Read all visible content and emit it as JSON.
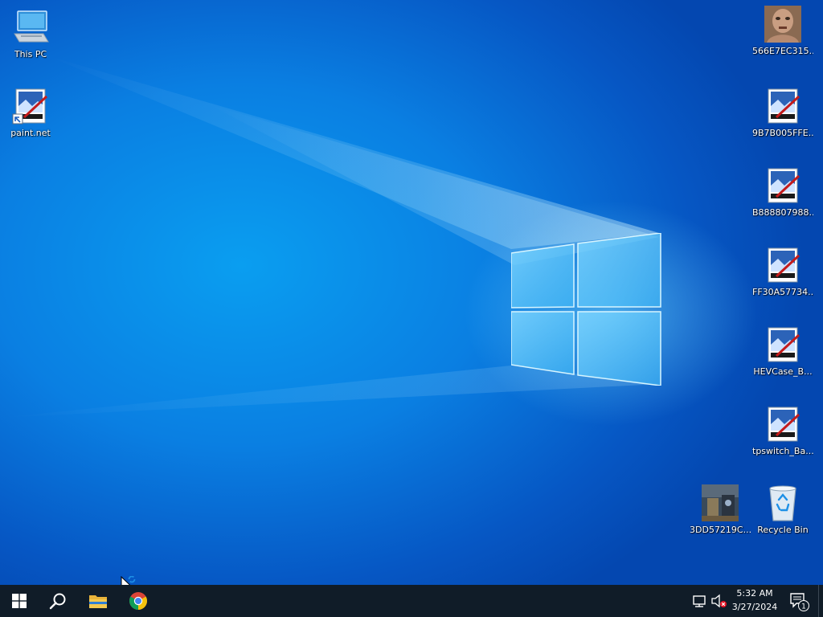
{
  "desktop_icons": {
    "this_pc": "This PC",
    "paintnet": "paint.net",
    "img_566": "566E7EC315...",
    "img_9b7": "9B7B005FFE...",
    "img_b88": "B888807988...",
    "img_ff3": "FF30A57734...",
    "img_hev": "HEVCase_B...",
    "img_tps": "tpswitch_Ba...",
    "img_3dd": "3DD57219C...",
    "recycle_bin": "Recycle Bin"
  },
  "taskbar": {
    "pinned": [
      "start-icon",
      "search-icon",
      "file-explorer-icon",
      "chrome-icon"
    ],
    "clock_time": "5:32 AM",
    "clock_date": "3/27/2024",
    "notification_count": "1"
  },
  "colors": {
    "taskbar_bg": "#101c28",
    "wallpaper_main": "#0a7fe2",
    "wallpaper_glow": "#78dcff"
  }
}
